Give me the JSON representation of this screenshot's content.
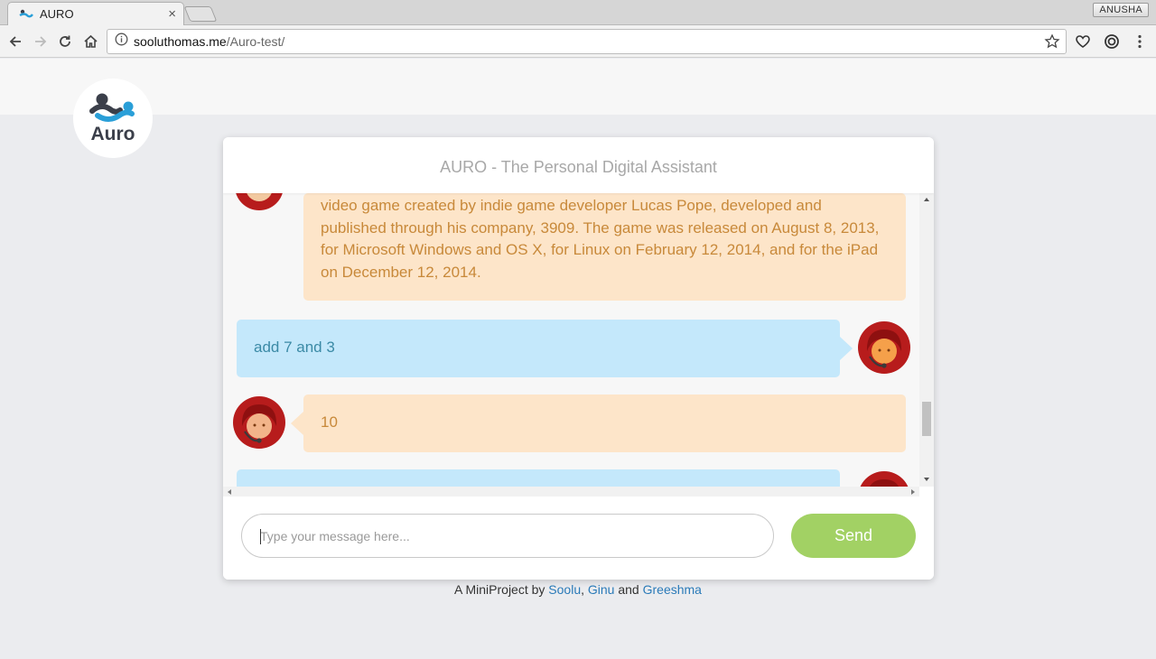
{
  "browser": {
    "tab_title": "AURO",
    "tab_close": "×",
    "profile_name": "ANUSHA",
    "url_host": "sooluthomas.me",
    "url_path": "/Auro-test/"
  },
  "page": {
    "logo_text": "Auro",
    "card_title": "AURO - The Personal Digital Assistant"
  },
  "chat": {
    "messages": [
      {
        "sender": "bot",
        "text": "video game created by indie game developer Lucas Pope, developed and published through his company, 3909. The game was released on August 8, 2013, for Microsoft Windows and OS X, for Linux on February 12, 2014, and for the iPad on December 12, 2014."
      },
      {
        "sender": "user",
        "text": "add 7 and 3"
      },
      {
        "sender": "bot",
        "text": "10"
      },
      {
        "sender": "user",
        "text": ""
      }
    ]
  },
  "input": {
    "placeholder": "Type your message here...",
    "value": "",
    "send_label": "Send"
  },
  "footer": {
    "prefix": "A MiniProject by ",
    "author1": "Soolu",
    "sep1": ", ",
    "author2": "Ginu",
    "sep2": " and ",
    "author3": "Greeshma"
  },
  "colors": {
    "bot_bubble": "#fde5c9",
    "bot_text": "#c8893a",
    "user_bubble": "#c4e8fb",
    "user_text": "#3b8aa6",
    "send_button": "#a2d164",
    "link": "#2a7ab8",
    "avatar_red": "#b71c1c"
  }
}
